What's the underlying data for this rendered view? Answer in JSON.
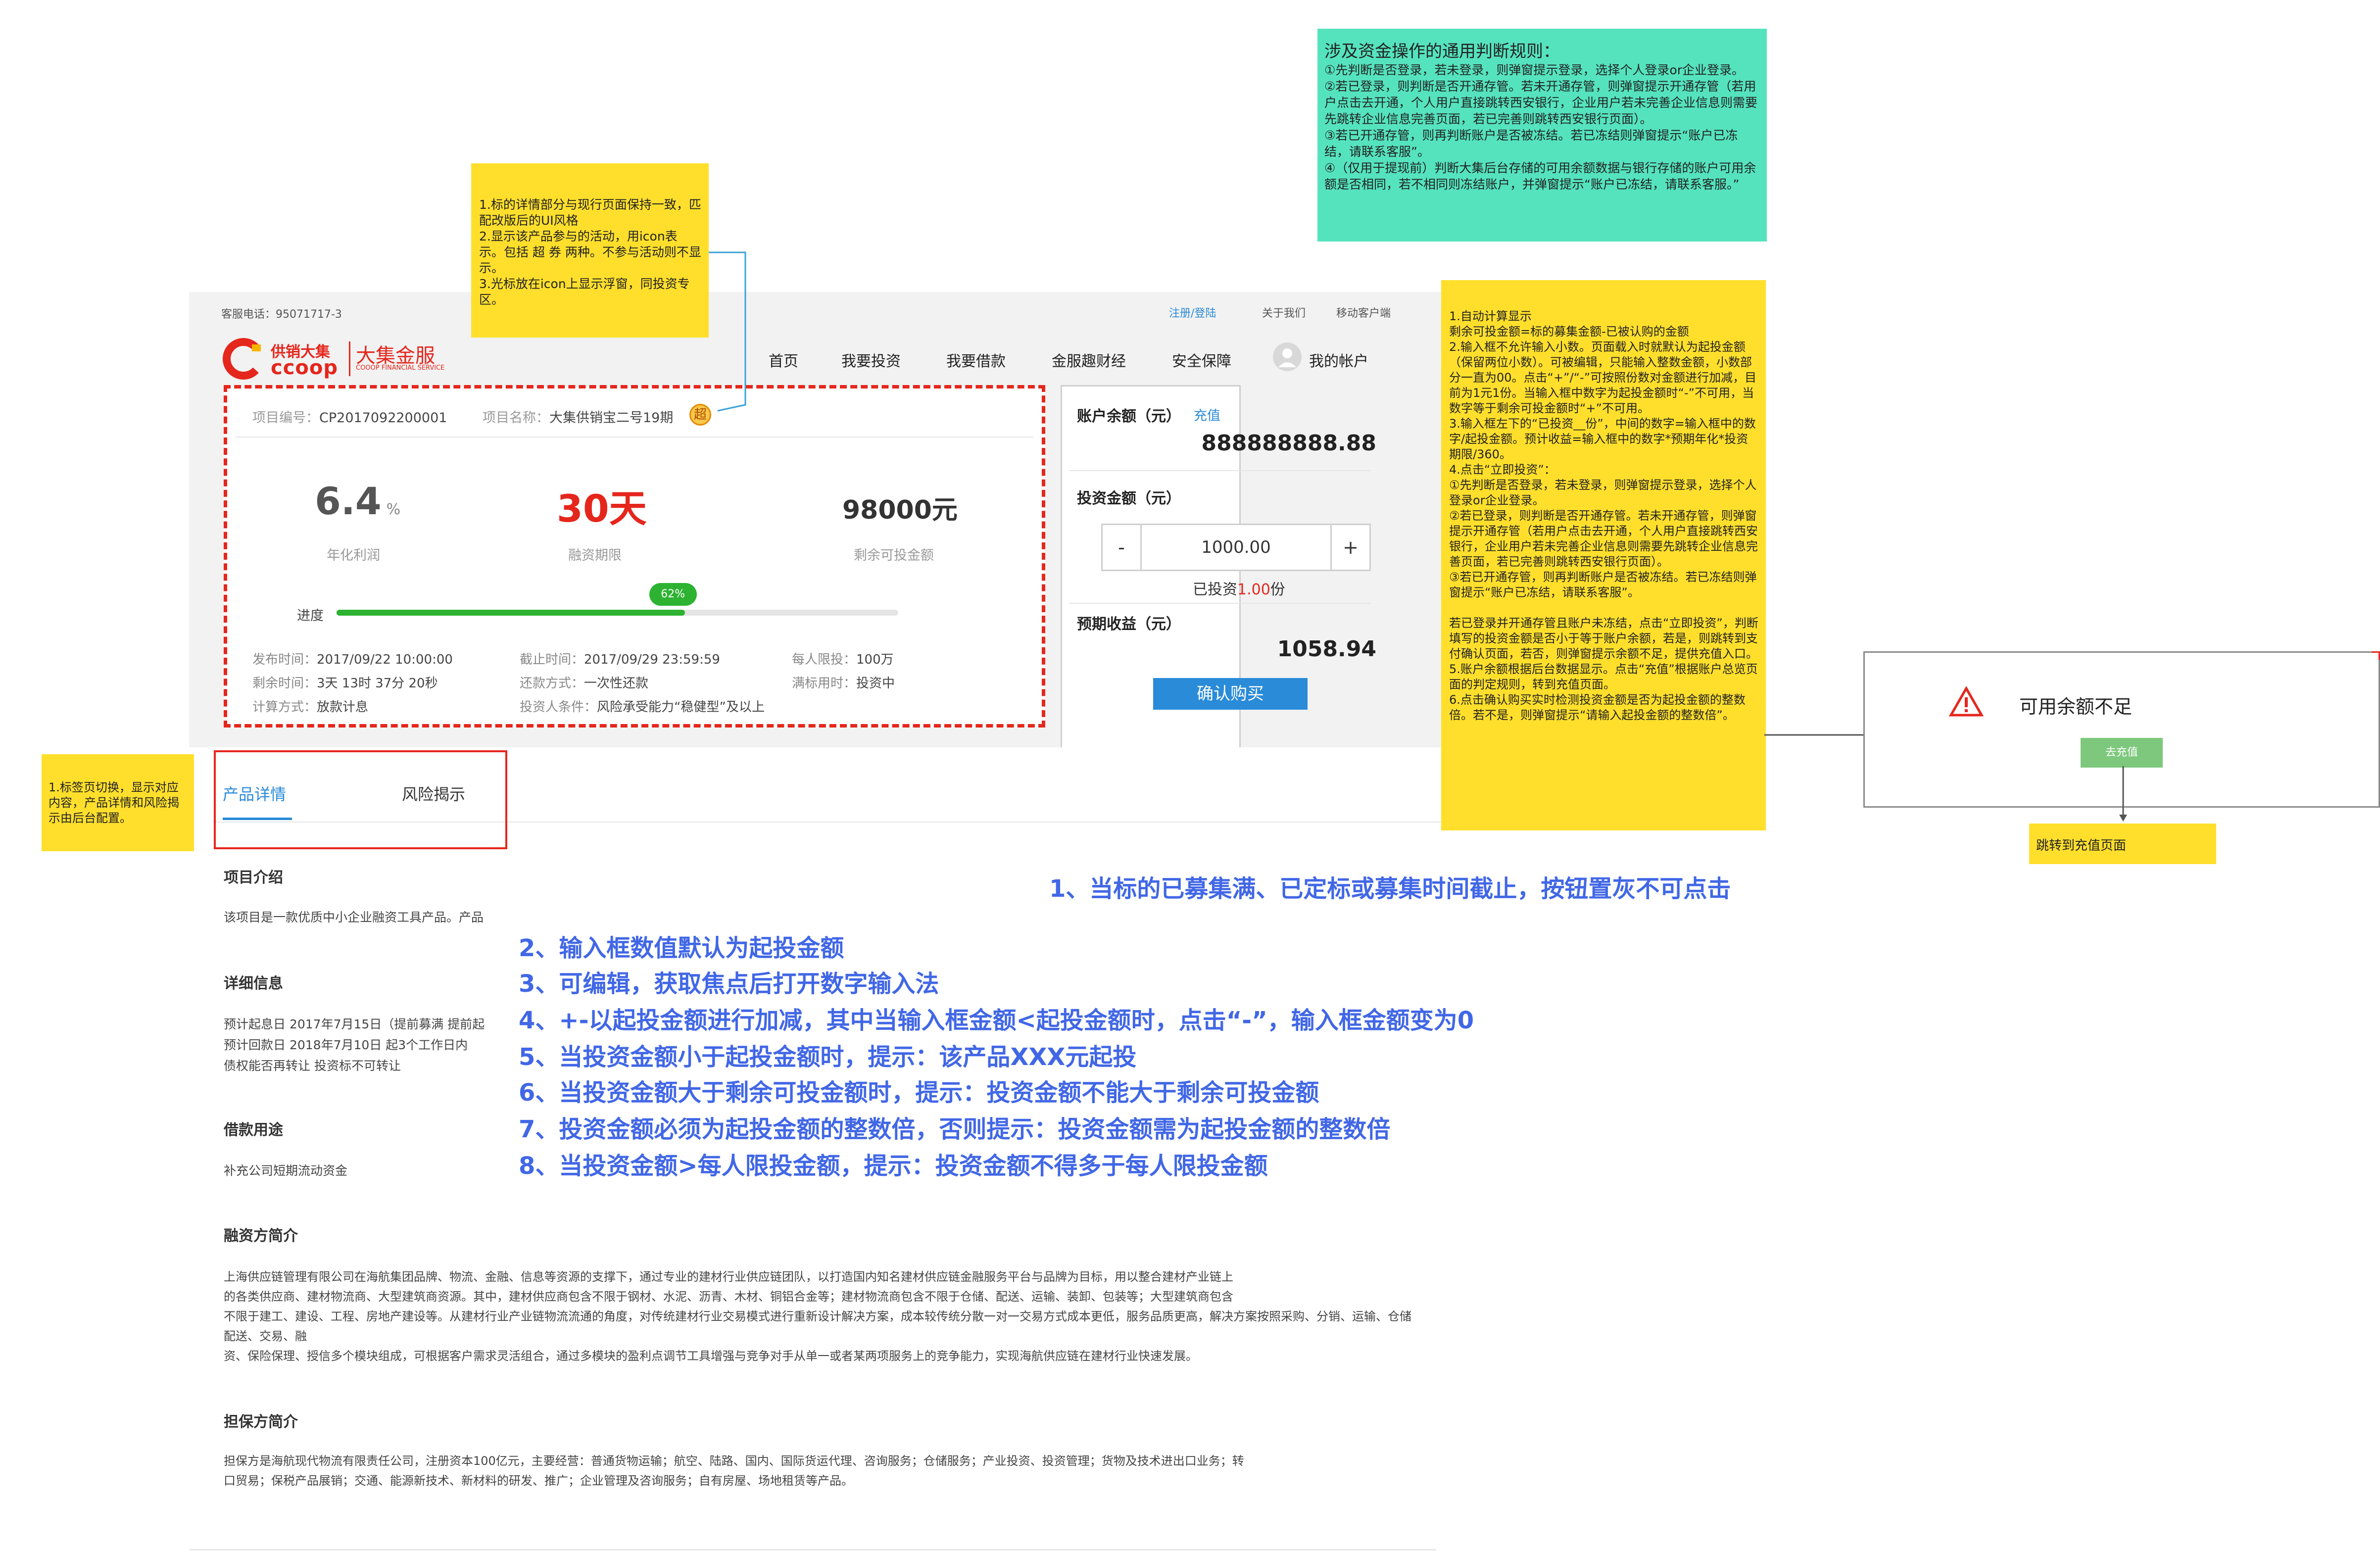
{
  "header": {
    "hotline": "客服电话：95071717-3",
    "top_links": [
      "注册/登陆",
      "关于我们",
      "移动客户端"
    ],
    "logo_main": "供销大集",
    "logo_sub": "ccoop",
    "logo_brand": "大集金服",
    "logo_brand_en": "COOOP FINANCIAL SERVICE",
    "nav": [
      "首页",
      "我要投资",
      "我要借款",
      "金服趣财经",
      "安全保障",
      "我的帐户"
    ]
  },
  "project": {
    "id_label": "项目编号：",
    "id": "CP2017092200001",
    "name_label": "项目名称：",
    "name": "大集供销宝二号19期",
    "badge": "超",
    "rate": "6.4",
    "rate_unit": "%",
    "rate_label": "年化利润",
    "term": "30天",
    "term_label": "融资期限",
    "remain": "98000元",
    "remain_label": "剩余可投金额",
    "progress_label": "进度",
    "progress_value": 0.62,
    "progress_text": "62%",
    "details": [
      {
        "label": "发布时间：",
        "value": "2017/09/22 10:00:00"
      },
      {
        "label": "截止时间：",
        "value": "2017/09/29 23:59:59"
      },
      {
        "label": "每人限投：",
        "value": "100万"
      },
      {
        "label": "剩余时间：",
        "value": "3天 13时 37分 20秒"
      },
      {
        "label": "还款方式：",
        "value": "一次性还款"
      },
      {
        "label": "满标用时：",
        "value": "投资中"
      },
      {
        "label": "计算方式：",
        "value": "放款计息"
      },
      {
        "label": "投资人条件：",
        "value": "风险承受能力“稳健型”及以上"
      }
    ]
  },
  "invest_panel": {
    "balance_label": "账户余额（元）",
    "recharge_link": "充值",
    "balance": "888888888.88",
    "amount_label": "投资金额（元）",
    "minus": "-",
    "amount_value": "1000.00",
    "plus": "+",
    "invested_prefix": "已投资",
    "invested_count": "1.00",
    "invested_suffix": "份",
    "expected_label": "预期收益（元）",
    "expected_value": "1058.94",
    "confirm_button": "确认购买"
  },
  "tabs": [
    "产品详情",
    "风险揭示"
  ],
  "content": {
    "intro_title": "项目介绍",
    "intro_text": "该项目是一款优质中小企业融资工具产品。产品",
    "detail_title": "详细信息",
    "detail_lines": [
      "预计起息日    2017年7月15日（提前募满 提前起",
      "预计回款日    2018年7月10日 起3个工作日内",
      "债权能否再转让    投资标不可转让"
    ],
    "usage_title": "借款用途",
    "usage_text": "补充公司短期流动资金",
    "financier_title": "融资方简介",
    "financier_text": "上海供应链管理有限公司在海航集团品牌、物流、金融、信息等资源的支撑下，通过专业的建材行业供应链团队，以打造国内知名建材供应链金融服务平台与品牌为目标，用以整合建材产业链上\n的各类供应商、建材物流商、大型建筑商资源。其中，建材供应商包含不限于钢材、水泥、沥青、木材、铜铝合金等；建材物流商包含不限于仓储、配送、运输、装卸、包装等；大型建筑商包含\n不限于建工、建设、工程、房地产建设等。从建材行业产业链物流流通的角度，对传统建材行业交易模式进行重新设计解决方案，成本较传统分散一对一交易方式成本更低，服务品质更高，解决方案按照采购、分销、运输、仓储配送、交易、融\n资、保险保理、授信多个模块组成，可根据客户需求灵活组合，通过多模块的盈利点调节工具增强与竞争对手从单一或者某两项服务上的竞争能力，实现海航供应链在建材行业快速发展。",
    "guarantor_title": "担保方简介",
    "guarantor_text": "担保方是海航现代物流有限责任公司，注册资本100亿元，主要经营：普通货物运输；航空、陆路、国内、国际货运代理、咨询服务；仓储服务；产业投资、投资管理；货物及技术进出口业务；转\n口贸易；保税产品展销；交通、能源新技术、新材料的研发、推广；企业管理及咨询服务；自有房屋、场地租赁等产品。"
  },
  "rules": [
    "1、当标的已募集满、已定标或募集时间截止，按钮置灰不可点击",
    "2、输入框数值默认为起投金额",
    "3、可编辑，获取焦点后打开数字输入法",
    "4、+-以起投金额进行加减，其中当输入框金额<起投金额时，点击“-”，输入框金额变为0",
    "5、当投资金额小于起投金额时，提示：该产品XXX元起投",
    "6、当投资金额大于剩余可投金额时，提示：投资金额不能大于剩余可投金额",
    "7、投资金额必须为起投金额的整数倍，否则提示：投资金额需为起投金额的整数倍",
    "8、当投资金额>每人限投金额，提示：投资金额不得多于每人限投金额"
  ],
  "notes": {
    "teal_title": "涉及资金操作的通用判断规则：",
    "teal_body": "①先判断是否登录，若未登录，则弹窗提示登录，选择个人登录or企业登录。\n②若已登录，则判断是否开通存管。若未开通存管，则弹窗提示开通存管（若用户点击去开通，个人用户直接跳转西安银行，企业用户若未完善企业信息则需要先跳转企业信息完善页面，若已完善则跳转西安银行页面）。\n③若已开通存管，则再判断账户是否被冻结。若已冻结则弹窗提示“账户已冻结，请联系客服”。\n④（仅用于提现前）判断大集后台存储的可用余额数据与银行存储的账户可用余额是否相同，若不相同则冻结账户，并弹窗提示“账户已冻结，请联系客服。”",
    "detail_note": "1.标的详情部分与现行页面保持一致，匹配改版后的UI风格\n2.显示该产品参与的活动，用icon表示。包括 超 券 两种。不参与活动则不显示。\n3.光标放在icon上显示浮窗，同投资专区。",
    "calc_note": "1.自动计算显示\n剩余可投金额=标的募集金额-已被认购的金额\n2.输入框不允许输入小数。页面载入时就默认为起投金额（保留两位小数）。可被编辑，只能输入整数金额，小数部分一直为00。点击“+”/“-”可按照份数对金额进行加减，目前为1元1份。当输入框中数字为起投金额时“-”不可用，当数字等于剩余可投金额时“+”不可用。\n3.输入框左下的“已投资__份”，中间的数字=输入框中的数字/起投金额。预计收益=输入框中的数字*预期年化*投资期限/360。\n4.点击“立即投资”：\n①先判断是否登录，若未登录，则弹窗提示登录，选择个人登录or企业登录。\n②若已登录，则判断是否开通存管。若未开通存管，则弹窗提示开通存管（若用户点击去开通，个人用户直接跳转西安银行，企业用户若未完善企业信息则需要先跳转企业信息完善页面，若已完善则跳转西安银行页面）。\n③若已开通存管，则再判断账户是否被冻结。若已冻结则弹窗提示“账户已冻结，请联系客服”。\n\n若已登录并开通存管且账户未冻结，点击“立即投资”，判断填写的投资金额是否小于等于账户余额，若是，则跳转到支付确认页面，若否，则弹窗提示余额不足，提供充值入口。\n5.账户余额根据后台数据显示。点击“充值”根据账户总览页面的判定规则，转到充值页面。\n6.点击确认购买实时检测投资金额是否为起投金额的整数倍。若不是，则弹窗提示“请输入起投金额的整数倍”。",
    "tab_note": "1.标签页切换，显示对应内容，产品详情和风险揭示由后台配置。",
    "recharge_note": "跳转到充值页面"
  },
  "dialog": {
    "title": "可用余额不足",
    "button": "去充值"
  },
  "colors": {
    "accent_red": "#e5261c",
    "accent_blue": "#2a8bd8",
    "progress_green": "#2db232",
    "note_yellow": "#ffdf2c",
    "note_teal": "#55e3be",
    "rule_blue": "#4167e6"
  }
}
